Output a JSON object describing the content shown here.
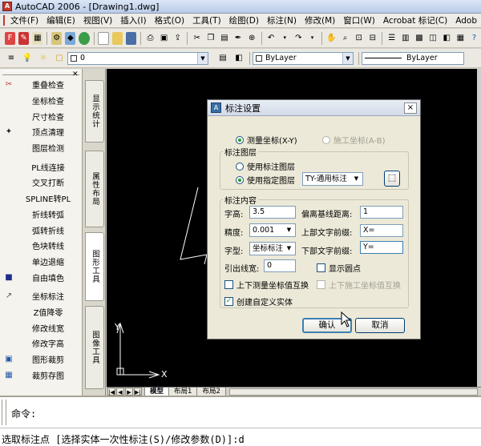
{
  "window": {
    "title": "AutoCAD 2006 - [Drawing1.dwg]"
  },
  "menu": [
    "文件(F)",
    "编辑(E)",
    "视图(V)",
    "插入(I)",
    "格式(O)",
    "工具(T)",
    "绘图(D)",
    "标注(N)",
    "修改(M)",
    "窗口(W)",
    "Acrobat 标记(C)",
    "Adob"
  ],
  "toolbar2": {
    "layer_value": "0",
    "linetype_value": "ByLayer",
    "lineweight_value": "ByLayer"
  },
  "left_tools": [
    {
      "label": "重叠检查",
      "icon": "overlap-check-icon"
    },
    {
      "label": "坐标检查",
      "icon": ""
    },
    {
      "label": "尺寸检查",
      "icon": ""
    },
    {
      "label": "顶点清理",
      "icon": "vertex-cleanup-icon"
    },
    {
      "label": "图层检测",
      "icon": ""
    },
    {
      "label": "PL线连接",
      "icon": ""
    },
    {
      "label": "交叉打断",
      "icon": ""
    },
    {
      "label": "SPLINE转PL",
      "icon": ""
    },
    {
      "label": "折线转弧",
      "icon": ""
    },
    {
      "label": "弧转折线",
      "icon": ""
    },
    {
      "label": "色块转线",
      "icon": ""
    },
    {
      "label": "单边退缩",
      "icon": ""
    },
    {
      "label": "自由填色",
      "icon": "fill-color-icon"
    },
    {
      "label": "坐标标注",
      "icon": "coordinate-label-icon"
    },
    {
      "label": "Z值降零",
      "icon": ""
    },
    {
      "label": "修改线宽",
      "icon": ""
    },
    {
      "label": "修改字高",
      "icon": ""
    },
    {
      "label": "图形裁剪",
      "icon": "clip-icon"
    },
    {
      "label": "裁剪存图",
      "icon": "clip-save-icon"
    }
  ],
  "vertical_tabs": [
    "显示统计",
    "属性布局",
    "图形工具",
    "图像工具"
  ],
  "canvas": {
    "axis_y": "Y",
    "axis_x": "X"
  },
  "layout_tabs": [
    "模型",
    "布局1",
    "布局2"
  ],
  "command": {
    "prompt": "命令:",
    "current": "选取标注点 [选择实体一次性标注(S)/修改参数(D)]:d"
  },
  "dialog": {
    "title": "标注设置",
    "close_glyph": "×",
    "mode_options": [
      {
        "label": "测量坐标(X-Y)",
        "selected": true,
        "disabled": false
      },
      {
        "label": "施工坐标(A-B)",
        "selected": false,
        "disabled": true
      }
    ],
    "layer_group": {
      "title": "标注图层",
      "use_label_layer": "使用标注图层",
      "use_specified_layer": "使用指定图层",
      "layer_value": "TY-通用标注"
    },
    "content_group": {
      "title": "标注内容",
      "text_height_label": "字高:",
      "text_height_value": "3.5",
      "offset_label": "偏离基线距离:",
      "offset_value": "1",
      "precision_label": "精度:",
      "precision_value": "0.001",
      "upper_prefix_label": "上部文字前缀:",
      "upper_prefix_value": "X=",
      "font_label": "字型:",
      "font_value": "坐标标注",
      "lower_prefix_label": "下部文字前缀:",
      "lower_prefix_value": "Y=",
      "leader_width_label": "引出线宽:",
      "leader_width_value": "0",
      "show_dot_label": "显示圆点",
      "swap_measure_label": "上下测量坐标值互换",
      "swap_construct_label": "上下施工坐标值互换",
      "create_entity_label": "创建自定义实体"
    },
    "ok_label": "确认",
    "cancel_label": "取消"
  }
}
